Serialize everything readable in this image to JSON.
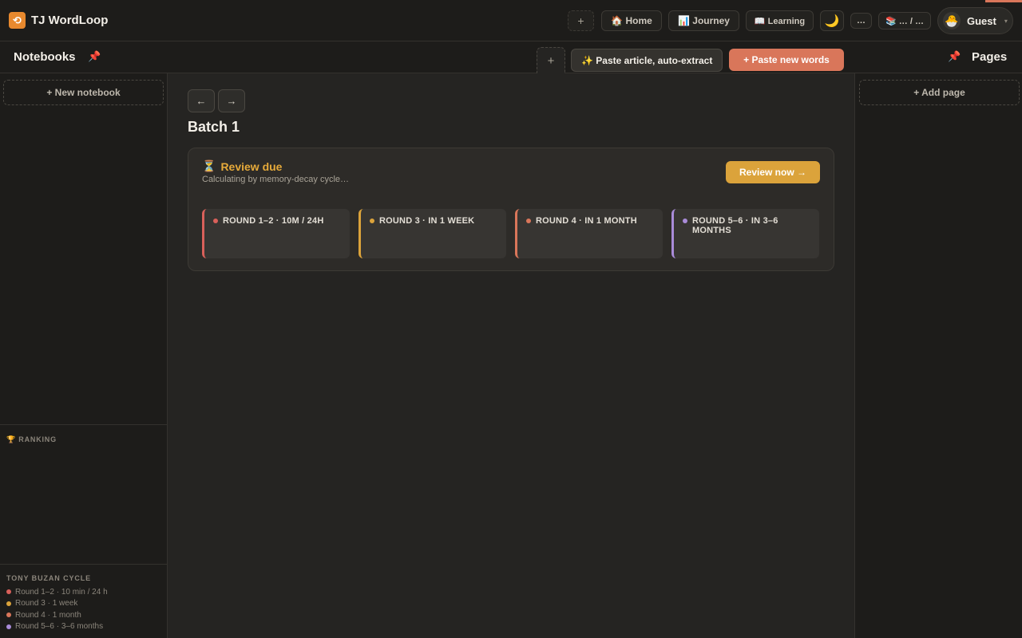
{
  "app": {
    "title": "TJ WordLoop",
    "logo_glyph": "⟲"
  },
  "topbar": {
    "add_label": "+",
    "home_label": "🏠 Home",
    "journey_label": "📊 Journey",
    "learning_label": "📖 Learning",
    "theme_icon": "🌙",
    "more_label": "…",
    "library_label": "📚 … / …",
    "user": {
      "name": "Guest",
      "avatar_glyph": "🐣",
      "caret": "▾"
    }
  },
  "subbar": {
    "left_title": "Notebooks",
    "right_title": "Pages",
    "pin_icon": "📌",
    "add_tab_label": "+",
    "paste_article_label": "✨ Paste article, auto-extract",
    "paste_words_label": "+ Paste new words"
  },
  "left_sidebar": {
    "new_notebook_label": "+ New notebook",
    "ranking_title": "🏆 RANKING",
    "cycle": {
      "title": "TONY BUZAN CYCLE",
      "items": [
        {
          "label": "Round 1–2 · 10 min / 24 h",
          "color": "#d9605a"
        },
        {
          "label": "Round 3 · 1 week",
          "color": "#dba33b"
        },
        {
          "label": "Round 4 · 1 month",
          "color": "#d9765a"
        },
        {
          "label": "Round 5–6 · 3–6 months",
          "color": "#a98bd8"
        }
      ]
    }
  },
  "right_sidebar": {
    "add_page_label": "+ Add page"
  },
  "main": {
    "prev_label": "←",
    "next_label": "→",
    "batch_title": "Batch 1",
    "review": {
      "icon": "⏳",
      "title": "Review due",
      "subtitle": "Calculating by memory-decay cycle…",
      "button_label": "Review now →",
      "rounds": [
        {
          "label": "ROUND 1–2 · 10M / 24H",
          "color": "#d9605a"
        },
        {
          "label": "ROUND 3 · IN 1 WEEK",
          "color": "#dba33b"
        },
        {
          "label": "ROUND 4 · IN 1 MONTH",
          "color": "#d9765a"
        },
        {
          "label": "ROUND 5–6 · IN 3–6 MONTHS",
          "color": "#a98bd8"
        }
      ]
    }
  }
}
